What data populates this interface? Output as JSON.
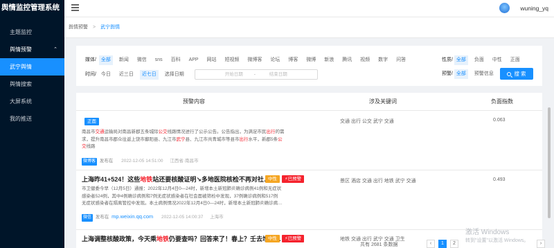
{
  "app": {
    "title": "舆情监控管理系统"
  },
  "sidebar": {
    "items": [
      {
        "label": "主题监控"
      },
      {
        "label": "舆情预警",
        "caret": "⌃"
      },
      {
        "label": "武宁舆情"
      },
      {
        "label": "舆情搜索"
      },
      {
        "label": "大屏系统"
      },
      {
        "label": "我的推送"
      }
    ]
  },
  "header": {
    "username": "wuning_yq"
  },
  "breadcrumb": {
    "items": [
      "舆情预警",
      "武宁舆情"
    ],
    "sep": ">"
  },
  "filters": {
    "media": {
      "label": "媒体/",
      "options": [
        "全部",
        "新闻",
        "微信",
        "sns",
        "百科",
        "APP",
        "网站",
        "短视频",
        "微博客",
        "论坛",
        "博客",
        "微博",
        "新浪",
        "腾讯",
        "视频",
        "数字",
        "问答"
      ],
      "selected": "全部"
    },
    "time": {
      "label": "时间/",
      "options": [
        "今日",
        "近三日",
        "近七日",
        "选择日期"
      ],
      "selected": "近七日",
      "start_placeholder": "开始日期",
      "range_sep": "-",
      "end_placeholder": "结束日期"
    },
    "sentiment": {
      "label": "性质/",
      "options": [
        "全部",
        "负面",
        "中性",
        "正面"
      ],
      "selected": "全部"
    },
    "alert": {
      "label": "预警/",
      "options": [
        "全部",
        "预警信息"
      ],
      "selected": "全部"
    },
    "search_label": "搜 索"
  },
  "table": {
    "columns": [
      "预警内容",
      "涉及关键词",
      "负面指数"
    ],
    "rows": [
      {
        "tags": [
          "正面"
        ],
        "summary_lines": [
          [
            "南昌市",
            "交通",
            "运输局对南昌新郡五条城际",
            "公交",
            "线路情况进行了公示公告。公告指出，为满足市民",
            "出行",
            "的需"
          ],
          [
            "求，提升南昌市郡众往返上饶市鄱阳县、九江市",
            "武宁",
            "县、九江市共青城市等县市",
            "出行",
            "水平，新郡5条",
            "公"
          ],
          [
            "交",
            "线路"
          ]
        ],
        "source": "微博客",
        "published_label": "发布在",
        "site": "",
        "time": "2022-12-05 14:51:00",
        "location": "江西省·南昌市",
        "keywords": "交通 出行 公交 武宁 交通",
        "score": "0.063"
      },
      {
        "title_parts": [
          "上海昨41+524！这些",
          "地铁",
          "站还要核酸证明↘多地医院核检不再对社…"
        ],
        "tags": [
          "中性",
          "⚡已预警"
        ],
        "summary_lines": [
          [
            "市卫健委今早（12月5日）通报：2022年12月4日0—24时，新增本土新冠肺炎确诊病例41例和无症状"
          ],
          [
            "感染者524例，其中4例确诊病例和7例无症状感染者在社会面被筛检中发现，37例确诊病例和517例"
          ],
          [
            "无症状感染者在隔离管控中发现。本土病例情况2022年12月4日0—24时，新增本土新冠肺炎确诊病…"
          ]
        ],
        "source": "微信",
        "published_label": "发布在",
        "site": "mp.weixin.qq.com",
        "time": "2022-12-05 14:00:37",
        "location": "上海市",
        "keywords": "景区 酒店 交通 出行 地铁 武宁 交通",
        "score": "0.493"
      },
      {
        "title_parts": [
          "上海调整核酸政策，今天乘",
          "地铁",
          "仍要查吗？回答来了！春上？壬去增核…"
        ],
        "tags": [
          "中性",
          "⚡已预警"
        ],
        "keywords": "地铁 交通 出行 武宁 交通 卫生",
        "score": ""
      }
    ]
  },
  "pagination": {
    "total": "共有 2681 条数据",
    "current": "1",
    "next": "2"
  },
  "watermark": {
    "line1": "激活 Windows",
    "line2": "转到\"设置\"以激活 Windows。"
  }
}
